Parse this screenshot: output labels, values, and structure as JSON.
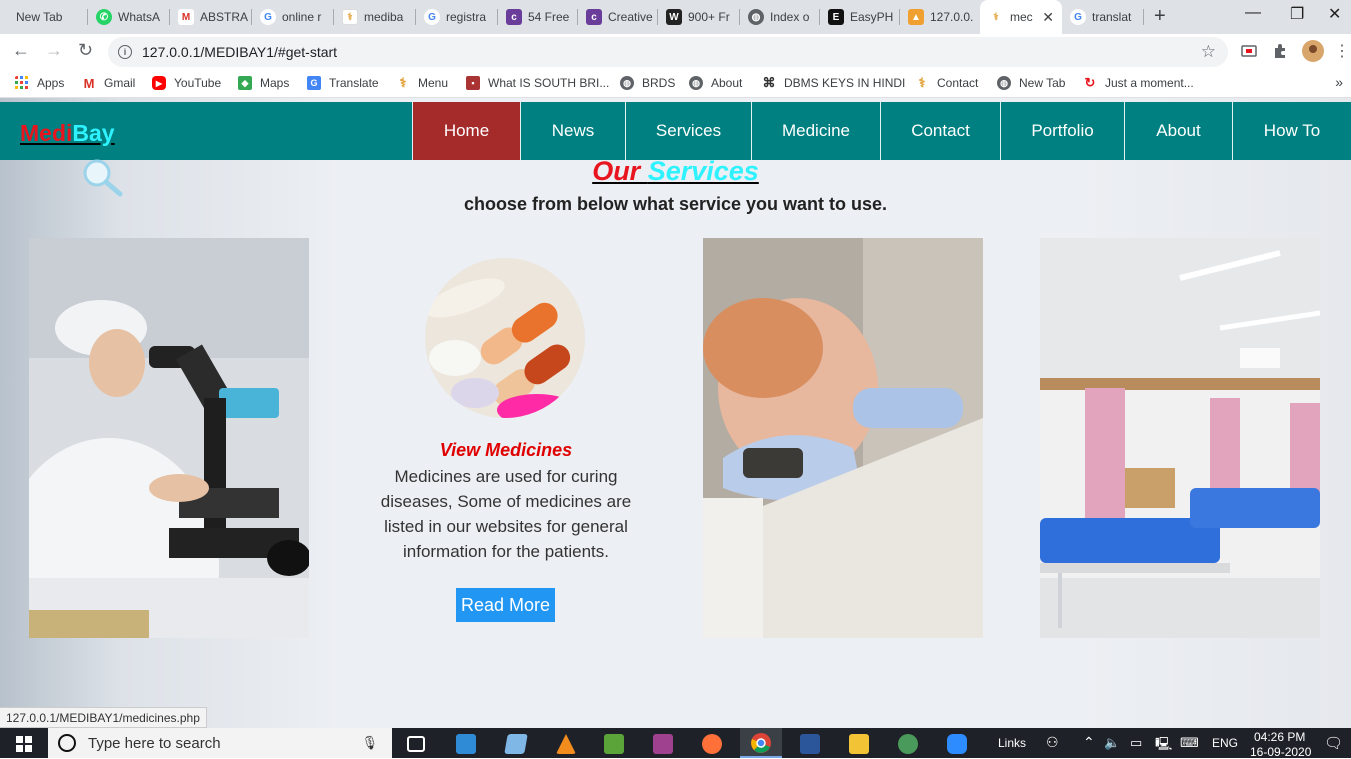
{
  "browser": {
    "tabs": [
      {
        "label": "New Tab",
        "icon": "none"
      },
      {
        "label": "WhatsA",
        "icon": "whatsapp-icon"
      },
      {
        "label": "ABSTRA",
        "icon": "gmail-icon"
      },
      {
        "label": "online r",
        "icon": "google-icon"
      },
      {
        "label": "mediba",
        "icon": "site-icon"
      },
      {
        "label": "registra",
        "icon": "google-icon"
      },
      {
        "label": "54 Free",
        "icon": "colorlib-icon"
      },
      {
        "label": "Creative",
        "icon": "colorlib-icon"
      },
      {
        "label": "900+ Fr",
        "icon": "w3-icon"
      },
      {
        "label": "Index o",
        "icon": "globe-icon"
      },
      {
        "label": "EasyPH",
        "icon": "easyphp-icon"
      },
      {
        "label": "127.0.0.",
        "icon": "phpmyadmin-icon"
      },
      {
        "label": "mec",
        "icon": "site-icon"
      },
      {
        "label": "translat",
        "icon": "google-icon"
      }
    ],
    "url": "127.0.0.1/MEDIBAY1/#get-start",
    "bookmarks": [
      {
        "label": "Apps"
      },
      {
        "label": "Gmail"
      },
      {
        "label": "YouTube"
      },
      {
        "label": "Maps"
      },
      {
        "label": "Translate"
      },
      {
        "label": "Menu"
      },
      {
        "label": "What IS SOUTH BRI..."
      },
      {
        "label": "BRDS"
      },
      {
        "label": "About"
      },
      {
        "label": "DBMS KEYS IN HINDI"
      },
      {
        "label": "Contact"
      },
      {
        "label": "New Tab"
      },
      {
        "label": "Just a moment..."
      }
    ],
    "status_url": "127.0.0.1/MEDIBAY1/medicines.php"
  },
  "site": {
    "logo_part1": "Medi",
    "logo_part2": "Bay",
    "nav": [
      "Home",
      "News",
      "Services",
      "Medicine",
      "Contact",
      "Portfolio",
      "About",
      "How To"
    ],
    "active_nav": "Home",
    "heading_part1": "Our ",
    "heading_part2": "Services",
    "subheading": "choose from below what service you want to use.",
    "card": {
      "title": "View Medicines",
      "text": "Medicines are used for curing diseases, Some of medicines are listed in our websites for general information for the patients.",
      "button": "Read More"
    },
    "colors": {
      "navbar": "#008080",
      "active": "#a52a2a",
      "logo_red": "#e8141e",
      "logo_cyan": "#2ff2ff",
      "button": "#2196f3"
    }
  },
  "taskbar": {
    "search_placeholder": "Type here to search",
    "links": "Links",
    "lang": "ENG",
    "time": "04:26 PM",
    "date": "16-09-2020"
  }
}
